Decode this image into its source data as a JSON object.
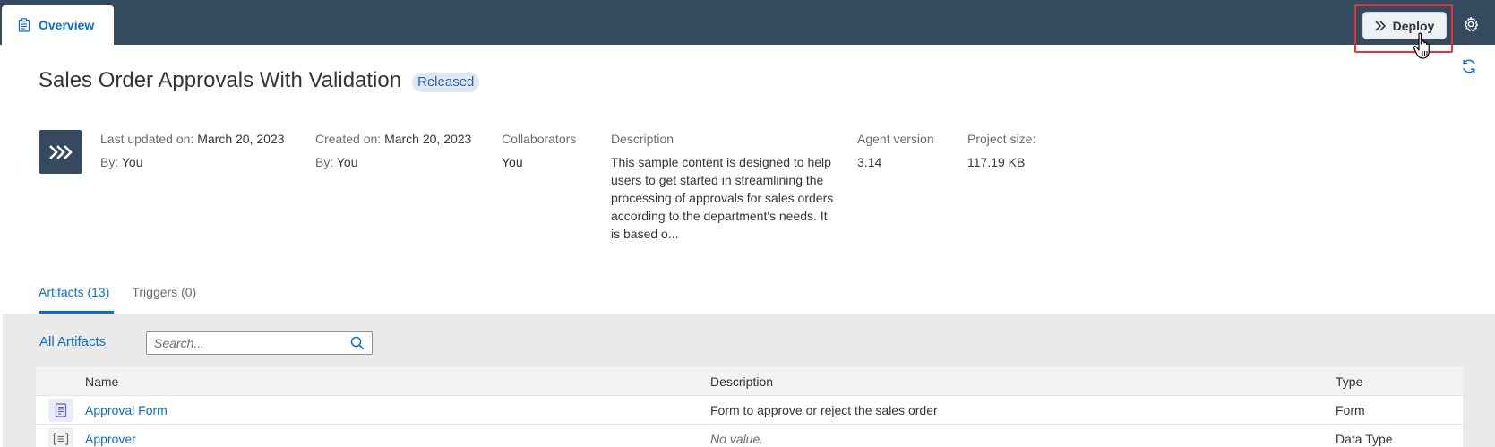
{
  "header": {
    "tab_overview": "Overview",
    "deploy_label": "Deploy"
  },
  "project": {
    "title": "Sales Order Approvals With Validation",
    "status": "Released",
    "last_updated_label": "Last updated on:",
    "last_updated_value": "March 20, 2023",
    "last_updated_by_label": "By:",
    "last_updated_by_value": "You",
    "created_label": "Created on:",
    "created_value": "March 20, 2023",
    "created_by_label": "By:",
    "created_by_value": "You",
    "collaborators_label": "Collaborators",
    "collaborators_value": "You",
    "description_label": "Description",
    "description_value": "This sample content is designed to help users to get started in streamlining the processing of approvals for sales orders according to the department's needs. It is based o...",
    "agent_version_label": "Agent version",
    "agent_version_value": "3.14",
    "project_size_label": "Project size:",
    "project_size_value": "117.19 KB"
  },
  "tabs": [
    {
      "label": "Artifacts (13)",
      "active": true
    },
    {
      "label": "Triggers (0)",
      "active": false
    }
  ],
  "artifacts": {
    "heading": "All Artifacts",
    "search_placeholder": "Search...",
    "columns": {
      "name": "Name",
      "description": "Description",
      "type": "Type"
    },
    "rows": [
      {
        "name": "Approval Form",
        "description": "Form to approve or reject the sales order",
        "type": "Form",
        "icon": "form-icon"
      },
      {
        "name": "Approver",
        "description": "No value.",
        "type": "Data Type",
        "icon": "data-type-icon"
      }
    ]
  },
  "colors": {
    "shell": "#354a5f",
    "accent": "#0a6ed1",
    "highlight": "#e0353b"
  }
}
